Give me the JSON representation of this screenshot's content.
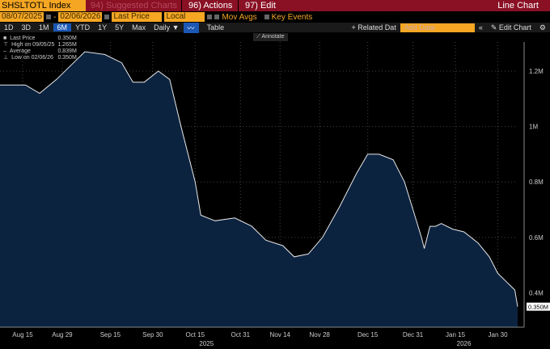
{
  "toolbar": {
    "ticker": "SHSLTOTL Index",
    "suggested": "94) Suggested Charts",
    "actions": "96) Actions",
    "edit": "97) Edit",
    "title": "Line Chart"
  },
  "params": {
    "start": "08/07/2025",
    "end": "02/06/2026",
    "field": "Last Price",
    "currency": "Local CCY",
    "mov_avgs": "Mov Avgs",
    "key_events": "Key Events"
  },
  "ranges": [
    "1D",
    "3D",
    "1M",
    "6M",
    "YTD",
    "1Y",
    "5Y",
    "Max"
  ],
  "selected_range": "6M",
  "frequency": "Daily",
  "table_label": "Table",
  "related": "+ Related Dat",
  "add_data_placeholder": "Add Data",
  "edit_chart": "Edit Chart",
  "annotate": "Annotate",
  "legend": [
    {
      "label": "Last Price",
      "value": "0.350M"
    },
    {
      "label": "High on 09/05/25",
      "value": "1.265M"
    },
    {
      "label": "Average",
      "value": "0.839M"
    },
    {
      "label": "Low on 02/06/26",
      "value": "0.350M"
    }
  ],
  "last_value_label": "0.350M",
  "chart_data": {
    "type": "area",
    "series": [
      {
        "name": "SHSLTOTL Index",
        "points": [
          [
            0,
            1.15
          ],
          [
            9,
            1.15
          ],
          [
            14,
            1.12
          ],
          [
            20,
            1.17
          ],
          [
            26,
            1.23
          ],
          [
            30,
            1.27
          ],
          [
            37,
            1.26
          ],
          [
            43,
            1.23
          ],
          [
            47,
            1.16
          ],
          [
            51,
            1.16
          ],
          [
            56,
            1.2
          ],
          [
            60,
            1.17
          ],
          [
            64,
            1.0
          ],
          [
            69,
            0.8
          ],
          [
            71,
            0.68
          ],
          [
            76,
            0.66
          ],
          [
            83,
            0.67
          ],
          [
            89,
            0.64
          ],
          [
            94,
            0.59
          ],
          [
            100,
            0.57
          ],
          [
            104,
            0.53
          ],
          [
            109,
            0.54
          ],
          [
            114,
            0.6
          ],
          [
            120,
            0.71
          ],
          [
            126,
            0.83
          ],
          [
            130,
            0.9
          ],
          [
            134,
            0.9
          ],
          [
            139,
            0.88
          ],
          [
            143,
            0.8
          ],
          [
            146,
            0.7
          ],
          [
            149,
            0.6
          ],
          [
            150,
            0.56
          ],
          [
            152,
            0.64
          ],
          [
            154,
            0.64
          ],
          [
            156,
            0.65
          ],
          [
            160,
            0.63
          ],
          [
            164,
            0.62
          ],
          [
            169,
            0.58
          ],
          [
            173,
            0.53
          ],
          [
            176,
            0.47
          ],
          [
            179,
            0.44
          ],
          [
            182,
            0.41
          ],
          [
            183,
            0.35
          ]
        ]
      }
    ],
    "x_ticks": [
      {
        "day": 8,
        "label": "Aug 15"
      },
      {
        "day": 22,
        "label": "Aug 29"
      },
      {
        "day": 39,
        "label": "Sep 15"
      },
      {
        "day": 54,
        "label": "Sep 30"
      },
      {
        "day": 69,
        "label": "Oct 15"
      },
      {
        "day": 85,
        "label": "Oct 31"
      },
      {
        "day": 99,
        "label": "Nov 14"
      },
      {
        "day": 113,
        "label": "Nov 28"
      },
      {
        "day": 130,
        "label": "Dec 15"
      },
      {
        "day": 146,
        "label": "Dec 31"
      },
      {
        "day": 161,
        "label": "Jan 15"
      },
      {
        "day": 176,
        "label": "Jan 30"
      }
    ],
    "years": [
      {
        "day": 73,
        "label": "2025"
      },
      {
        "day": 164,
        "label": "2026"
      }
    ],
    "y_ticks": [
      {
        "v": 0.4,
        "label": "0.4M"
      },
      {
        "v": 0.6,
        "label": "0.6M"
      },
      {
        "v": 0.8,
        "label": "0.8M"
      },
      {
        "v": 1.0,
        "label": "1M"
      },
      {
        "v": 1.2,
        "label": "1.2M"
      }
    ],
    "xlim": [
      0,
      183
    ],
    "ylim": [
      0.276,
      1.305
    ]
  }
}
